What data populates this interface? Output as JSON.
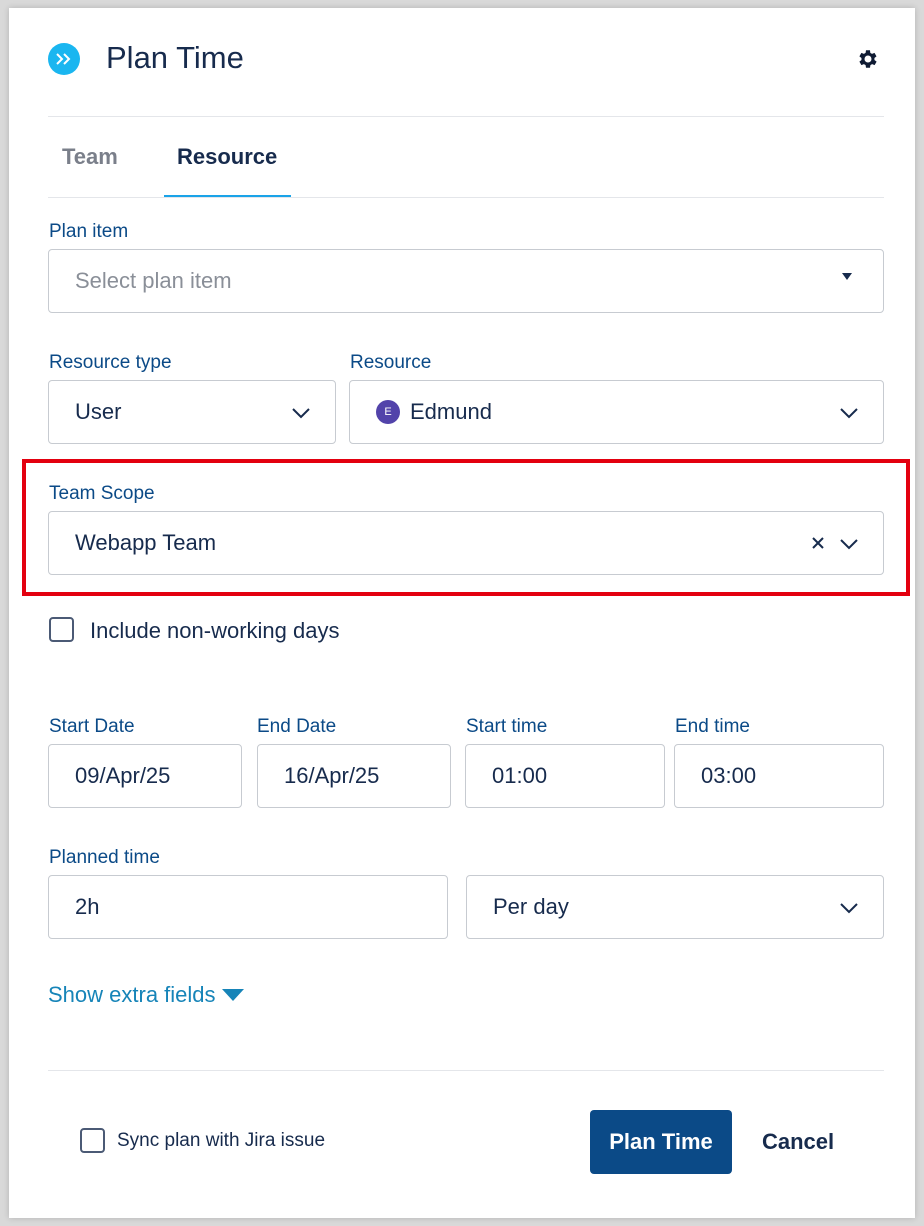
{
  "header": {
    "title": "Plan Time"
  },
  "tabs": [
    {
      "label": "Team",
      "active": false
    },
    {
      "label": "Resource",
      "active": true
    }
  ],
  "plan_item": {
    "label": "Plan item",
    "placeholder": "Select plan item"
  },
  "resource_type": {
    "label": "Resource type",
    "value": "User"
  },
  "resource": {
    "label": "Resource",
    "avatar_initial": "E",
    "value": "Edmund"
  },
  "team_scope": {
    "label": "Team Scope",
    "value": "Webapp Team"
  },
  "non_working": {
    "label": "Include non-working days",
    "checked": false
  },
  "start_date": {
    "label": "Start Date",
    "value": "09/Apr/25"
  },
  "end_date": {
    "label": "End Date",
    "value": "16/Apr/25"
  },
  "start_time": {
    "label": "Start time",
    "value": "01:00"
  },
  "end_time": {
    "label": "End time",
    "value": "03:00"
  },
  "planned_time": {
    "label": "Planned time",
    "value": "2h",
    "period": "Per day"
  },
  "extra_fields_link": "Show extra fields",
  "footer": {
    "sync_label": "Sync plan with Jira issue",
    "sync_checked": false,
    "primary_button": "Plan Time",
    "cancel_button": "Cancel"
  },
  "colors": {
    "accent": "#1ab6f0",
    "primary": "#0b4a87",
    "label": "#0b4a87",
    "highlight": "#e3000f",
    "avatar": "#5243aa"
  },
  "icons": {
    "logo": "double-chevron-right-icon",
    "settings": "gear-icon",
    "dropdown": "chevron-down-icon",
    "clear": "close-icon"
  }
}
